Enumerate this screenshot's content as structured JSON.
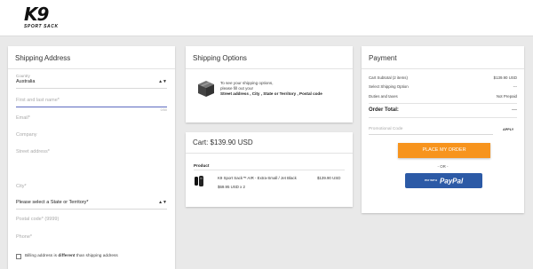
{
  "brand": {
    "logo_main": "K9",
    "logo_sub": "SPORT SACK"
  },
  "shipping_address": {
    "title": "Shipping Address",
    "country_label": "Country",
    "country_value": "Australia",
    "name_placeholder": "First and last name*",
    "name_counter": "0/50",
    "email_placeholder": "Email*",
    "company_placeholder": "Company",
    "street_placeholder": "Street address*",
    "city_placeholder": "City*",
    "state_value": "Please select a State or Territory*",
    "postal_placeholder": "Postal code* (9999)",
    "phone_placeholder": "Phone*",
    "billing_label_pre": "Billing address is ",
    "billing_label_bold": "different",
    "billing_label_post": " than shipping address"
  },
  "shipping_options": {
    "title": "Shipping Options",
    "msg_line1": "To see your shipping options,",
    "msg_line2": "please fill out your",
    "msg_line3": "Street address , City , State or Territory , Postal code"
  },
  "cart": {
    "title": "Cart:  $139.90 USD",
    "product_header": "Product",
    "items": [
      {
        "name": "K9 Sport Sack™ AIR - Extra-Small / Jet Black",
        "price": "$139.90 USD",
        "qty_line": "$69.95 USD x 2"
      }
    ]
  },
  "payment": {
    "title": "Payment",
    "rows": [
      {
        "label": "Cart Subtotal (2 items)",
        "value": "$139.90 USD"
      },
      {
        "label": "Select Shipping Option",
        "value": "---"
      },
      {
        "label": "Duties and taxes",
        "value": "Not Prepaid"
      }
    ],
    "order_total_label": "Order Total:",
    "order_total_value": "---",
    "promo_placeholder": "Promotional Code",
    "apply_label": "APPLY",
    "place_order_label": "PLACE MY ORDER",
    "or_label": "- OR -",
    "paypal_small": "PAY WITH",
    "paypal_word": "PayPal"
  },
  "colors": {
    "accent_orange": "#f7941d",
    "paypal_blue": "#2c5aa6",
    "focus_underline": "#5c6bc0"
  }
}
